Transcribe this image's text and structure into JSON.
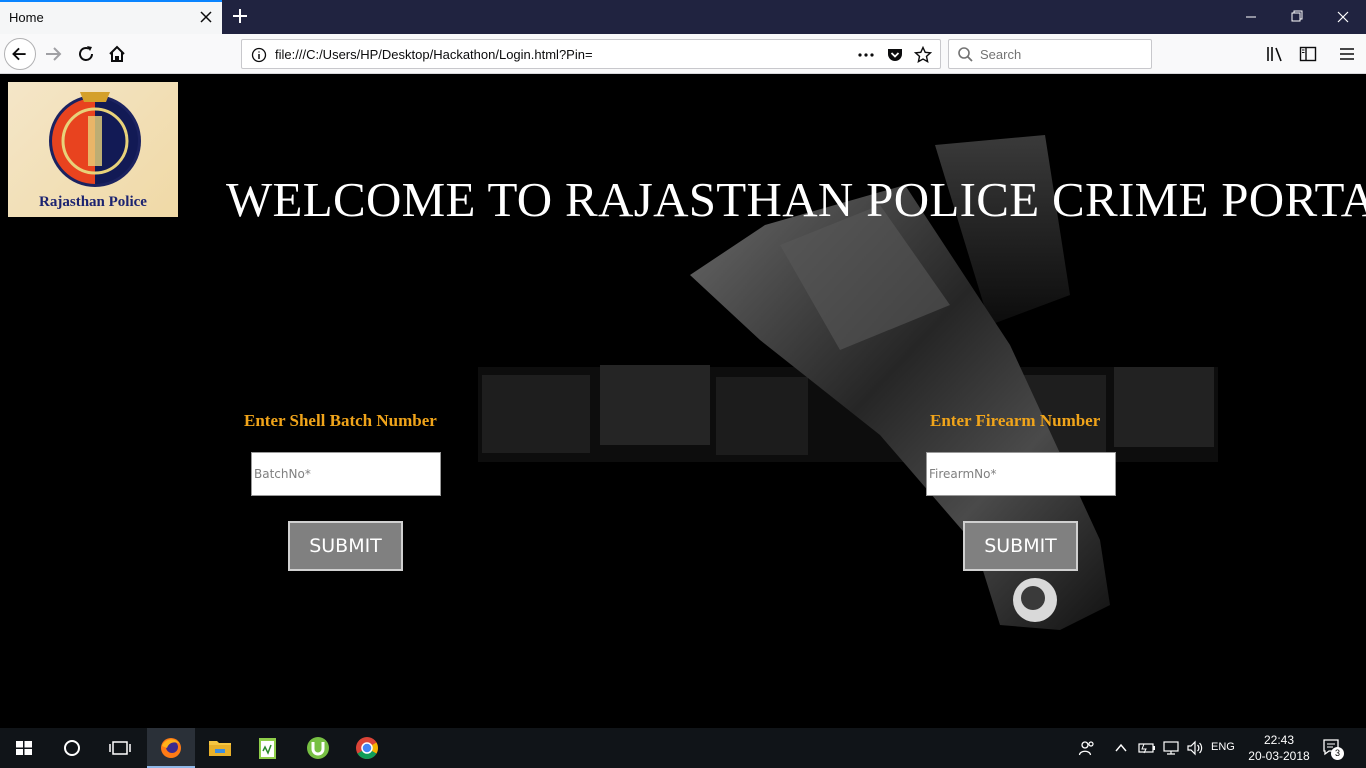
{
  "browser": {
    "tab_title": "Home",
    "url": "file:///C:/Users/HP/Desktop/Hackathon/Login.html?Pin=",
    "search_placeholder": "Search"
  },
  "page": {
    "logo_text": "Rajasthan Police",
    "welcome_heading": "WELCOME TO RAJASTHAN POLICE CRIME PORTAI",
    "shell_form": {
      "label": "Enter Shell Batch Number",
      "input_placeholder": "BatchNo*",
      "submit_label": "SUBMIT"
    },
    "firearm_form": {
      "label": "Enter Firearm Number",
      "input_placeholder": "FirearmNo*",
      "submit_label": "SUBMIT"
    }
  },
  "taskbar": {
    "language": "ENG",
    "time": "22:43",
    "date": "20-03-2018",
    "notification_count": "3"
  },
  "colors": {
    "tab_accent": "#0a84ff",
    "form_label": "#f0a41a",
    "submit_bg": "#808080",
    "logo_text": "#1c2370"
  },
  "icons": [
    "close-icon",
    "plus-icon",
    "minimize-icon",
    "restore-icon",
    "back-arrow-icon",
    "forward-arrow-icon",
    "reload-icon",
    "home-icon",
    "info-icon",
    "more-icon",
    "pocket-icon",
    "star-icon",
    "search-icon",
    "library-icon",
    "sidebar-icon",
    "menu-icon",
    "windows-start-icon",
    "cortana-icon",
    "task-view-icon",
    "firefox-icon",
    "file-explorer-icon",
    "notepad-icon",
    "utorrent-icon",
    "chrome-icon",
    "people-icon",
    "chevron-up-icon",
    "battery-icon",
    "network-icon",
    "volume-icon",
    "action-center-icon"
  ]
}
